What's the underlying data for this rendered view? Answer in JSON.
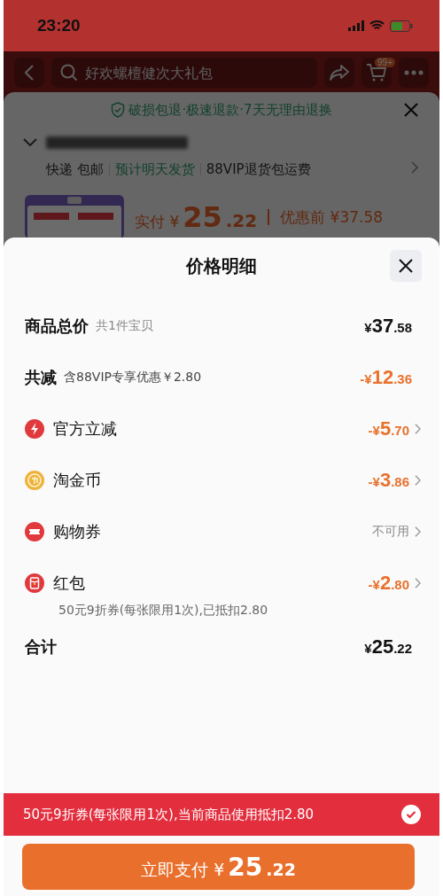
{
  "status_bar": {
    "time": "23:20"
  },
  "nav": {
    "search": {
      "placeholder": "好欢螺檀健次大礼包"
    },
    "cart_badge": "99+"
  },
  "background_sheet": {
    "guarantee": "破损包退·极速退款·7天无理由退换",
    "delivery": [
      {
        "text": "快递 包邮",
        "kind": "plain"
      },
      {
        "text": "预计明天发货",
        "kind": "green"
      },
      {
        "text": "88VIP退货包运费",
        "kind": "plain"
      }
    ],
    "paid_label": "实付",
    "paid": {
      "currency": "¥",
      "integer": "25",
      "decimal": ".22"
    },
    "before_label": "优惠前",
    "before": "¥37.58"
  },
  "price_detail": {
    "title": "价格明细",
    "rows": [
      {
        "kind": "total",
        "label": "商品总价",
        "note": "共1件宝贝",
        "amount": {
          "currency": "¥",
          "integer": "37",
          "decimal": ".58"
        }
      },
      {
        "kind": "reduction",
        "label": "共减",
        "note": "含88VIP专享优惠￥2.80",
        "amount": {
          "sign": "-",
          "currency": "¥",
          "integer": "12",
          "decimal": ".36"
        }
      },
      {
        "kind": "bolt",
        "label": "官方立减",
        "amount": {
          "sign": "-",
          "currency": "¥",
          "integer": "5",
          "decimal": ".70"
        }
      },
      {
        "kind": "coin",
        "label": "淘金币",
        "amount": {
          "sign": "-",
          "currency": "¥",
          "integer": "3",
          "decimal": ".86"
        }
      },
      {
        "kind": "ticket",
        "label": "购物券",
        "status": "不可用"
      },
      {
        "kind": "packet",
        "label": "红包",
        "amount": {
          "sign": "-",
          "currency": "¥",
          "integer": "2",
          "decimal": ".80"
        },
        "detail": "50元9折券(每张限用1次),已抵扣2.80"
      },
      {
        "kind": "sum",
        "label": "合计",
        "amount": {
          "currency": "¥",
          "integer": "25",
          "decimal": ".22"
        }
      }
    ]
  },
  "coupon_banner": {
    "text": "50元9折券(每张限用1次),当前商品使用抵扣2.80",
    "checked": true
  },
  "pay_button": {
    "label": "立即支付",
    "amount": {
      "currency": "¥",
      "integer": "25",
      "decimal": ".22"
    }
  }
}
